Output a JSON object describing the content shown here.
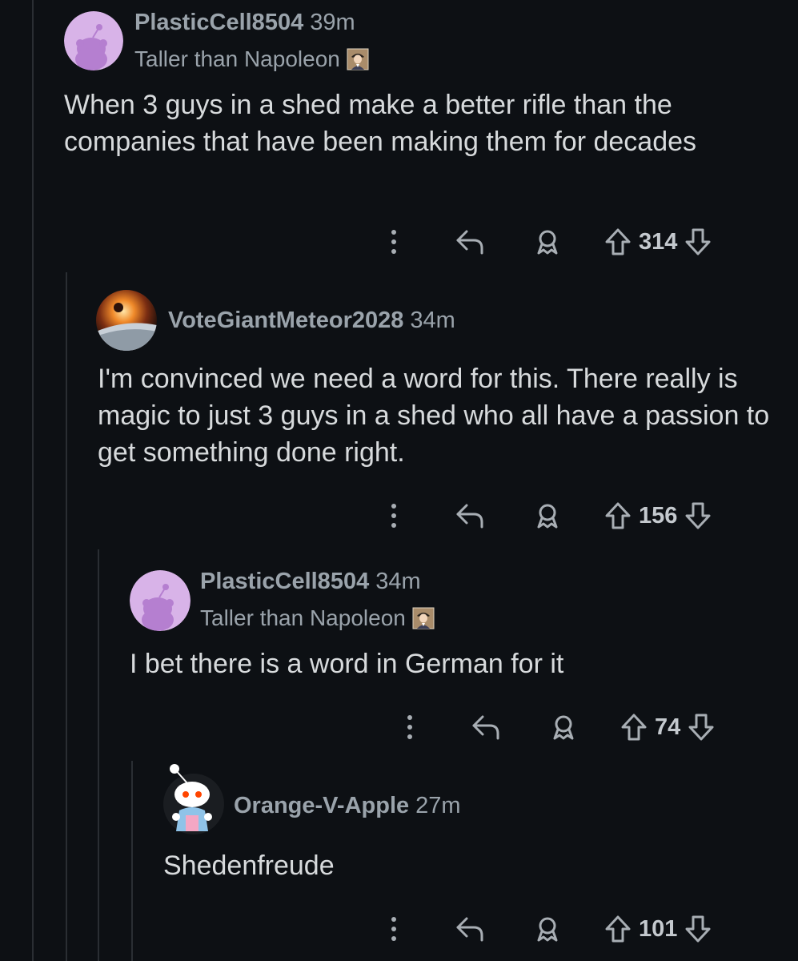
{
  "colors": {
    "background": "#0d1014",
    "thread_line": "#2a2e33",
    "meta_text": "#9aa3ab",
    "body_text": "#d7dadc",
    "snoo_avatar_bg": "#d8b3e8"
  },
  "icons": [
    "more-options-icon",
    "reply-icon",
    "award-icon",
    "upvote-icon",
    "downvote-icon",
    "napoleon-flair-icon"
  ],
  "comments": [
    {
      "username": "PlasticCell8504",
      "time": "39m",
      "flair": "Taller than Napoleon",
      "text": "When 3 guys in a shed make a better rifle than the companies that have been making them for decades",
      "votes": "314"
    },
    {
      "username": "VoteGiantMeteor2028",
      "time": "34m",
      "flair": "",
      "text": "I'm convinced we need a word for this. There really is magic to just 3 guys in a shed who all have a passion to get something done right.",
      "votes": "156"
    },
    {
      "username": "PlasticCell8504",
      "time": "34m",
      "flair": "Taller than Napoleon",
      "text": "I bet there is a word in German for it",
      "votes": "74"
    },
    {
      "username": "Orange-V-Apple",
      "time": "27m",
      "flair": "",
      "text": "Shedenfreude",
      "votes": "101"
    }
  ]
}
